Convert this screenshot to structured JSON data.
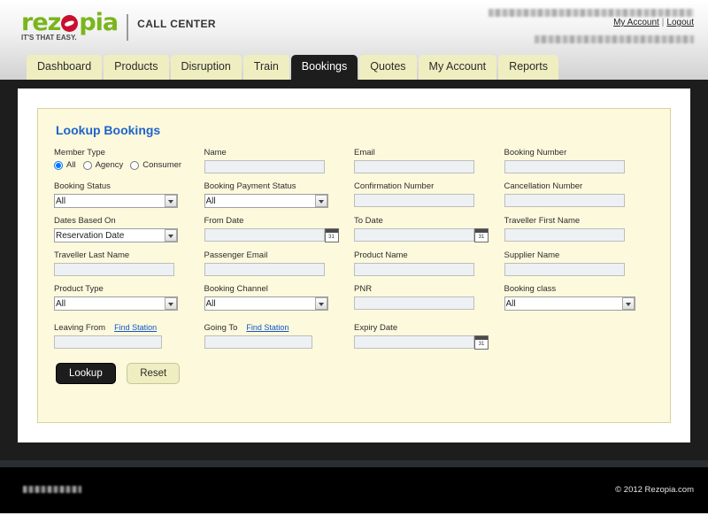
{
  "header": {
    "logo_part1": "rez",
    "logo_o_icon": "rezopia-o-icon",
    "logo_part2": "pia",
    "logo_tagline": "IT'S THAT EASY.",
    "app_name": "CALL CENTER",
    "my_account_link": "My Account",
    "link_separator": "|",
    "logout_link": "Logout"
  },
  "tabs": [
    {
      "label": "Dashboard",
      "active": false
    },
    {
      "label": "Products",
      "active": false
    },
    {
      "label": "Disruption",
      "active": false
    },
    {
      "label": "Train",
      "active": false
    },
    {
      "label": "Bookings",
      "active": true
    },
    {
      "label": "Quotes",
      "active": false
    },
    {
      "label": "My Account",
      "active": false
    },
    {
      "label": "Reports",
      "active": false
    }
  ],
  "panel": {
    "title": "Lookup Bookings",
    "member_type": {
      "label": "Member Type",
      "options": [
        {
          "label": "All",
          "selected": true
        },
        {
          "label": "Agency",
          "selected": false
        },
        {
          "label": "Consumer",
          "selected": false
        }
      ]
    },
    "fields": {
      "name": {
        "label": "Name",
        "value": ""
      },
      "email": {
        "label": "Email",
        "value": ""
      },
      "booking_number": {
        "label": "Booking Number",
        "value": ""
      },
      "booking_status": {
        "label": "Booking Status",
        "value": "All"
      },
      "booking_payment_status": {
        "label": "Booking Payment Status",
        "value": "All"
      },
      "confirmation_number": {
        "label": "Confirmation Number",
        "value": ""
      },
      "cancellation_number": {
        "label": "Cancellation Number",
        "value": ""
      },
      "dates_based_on": {
        "label": "Dates Based On",
        "value": "Reservation Date"
      },
      "from_date": {
        "label": "From Date",
        "value": ""
      },
      "to_date": {
        "label": "To Date",
        "value": ""
      },
      "traveller_first_name": {
        "label": "Traveller First Name",
        "value": ""
      },
      "traveller_last_name": {
        "label": "Traveller Last Name",
        "value": ""
      },
      "passenger_email": {
        "label": "Passenger Email",
        "value": ""
      },
      "product_name": {
        "label": "Product Name",
        "value": ""
      },
      "supplier_name": {
        "label": "Supplier Name",
        "value": ""
      },
      "product_type": {
        "label": "Product Type",
        "value": "All"
      },
      "booking_channel": {
        "label": "Booking Channel",
        "value": "All"
      },
      "pnr": {
        "label": "PNR",
        "value": ""
      },
      "booking_class": {
        "label": "Booking class",
        "value": "All"
      },
      "leaving_from": {
        "label": "Leaving From",
        "value": "",
        "link": "Find Station"
      },
      "going_to": {
        "label": "Going To",
        "value": "",
        "link": "Find Station"
      },
      "expiry_date": {
        "label": "Expiry Date",
        "value": ""
      }
    },
    "buttons": {
      "lookup": "Lookup",
      "reset": "Reset"
    }
  },
  "footer": {
    "copyright": "© 2012 Rezopia.com"
  }
}
